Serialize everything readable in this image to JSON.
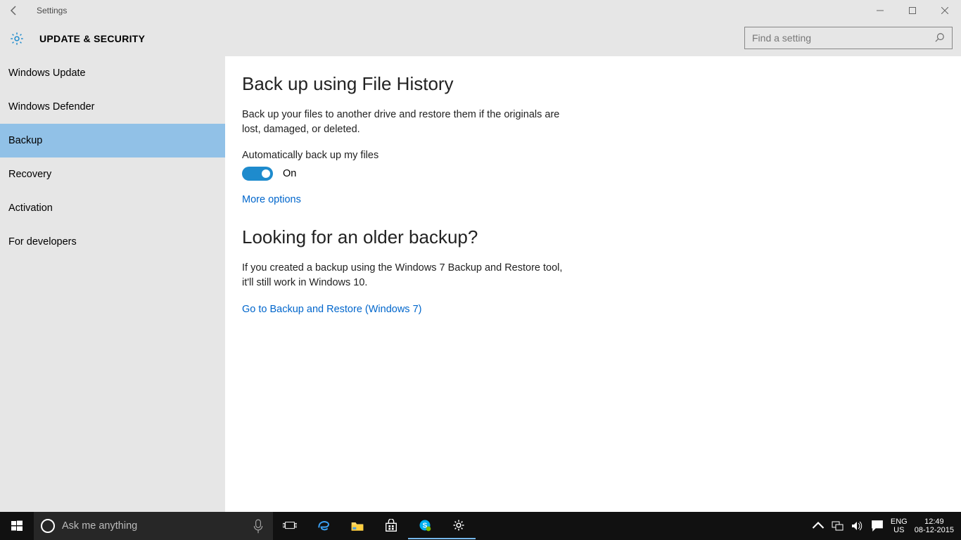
{
  "window": {
    "title": "Settings"
  },
  "header": {
    "section_title": "UPDATE & SECURITY",
    "search_placeholder": "Find a setting"
  },
  "sidebar": {
    "items": [
      {
        "label": "Windows Update"
      },
      {
        "label": "Windows Defender"
      },
      {
        "label": "Backup"
      },
      {
        "label": "Recovery"
      },
      {
        "label": "Activation"
      },
      {
        "label": "For developers"
      }
    ],
    "selected_index": 2
  },
  "content": {
    "heading1": "Back up using File History",
    "paragraph1": "Back up your files to another drive and restore them if the originals are lost, damaged, or deleted.",
    "toggle_label": "Automatically back up my files",
    "toggle_state": "On",
    "link1": "More options",
    "heading2": "Looking for an older backup?",
    "paragraph2": "If you created a backup using the Windows 7 Backup and Restore tool, it'll still work in Windows 10.",
    "link2": "Go to Backup and Restore (Windows 7)"
  },
  "taskbar": {
    "cortana_placeholder": "Ask me anything",
    "language_top": "ENG",
    "language_bottom": "US",
    "time": "12:49",
    "date": "08-12-2015"
  }
}
